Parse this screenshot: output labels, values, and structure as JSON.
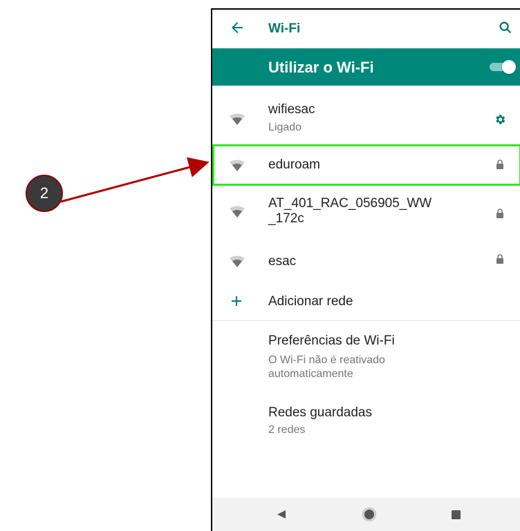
{
  "annotation": {
    "step_number": "2"
  },
  "appbar": {
    "title": "Wi-Fi",
    "back_icon": "arrow-left-icon",
    "search_icon": "search-icon"
  },
  "toggle": {
    "label": "Utilizar o Wi-Fi",
    "state": "on"
  },
  "networks": [
    {
      "name": "wifiesac",
      "status": "Ligado",
      "right_icon": "gear-icon"
    },
    {
      "name": "eduroam",
      "status": "",
      "right_icon": "lock-icon",
      "highlighted": true
    },
    {
      "name": "AT_401_RAC_056905_WW",
      "name_line2": "_172c",
      "status": "",
      "right_icon": "lock-icon"
    },
    {
      "name": "esac",
      "status": "",
      "right_icon": "lock-icon"
    }
  ],
  "add_network": {
    "label": "Adicionar rede",
    "icon": "plus-icon"
  },
  "preferences": {
    "title": "Preferências de Wi-Fi",
    "subtitle_line1": "O Wi-Fi não é reativado",
    "subtitle_line2": "automaticamente"
  },
  "saved": {
    "title": "Redes guardadas",
    "subtitle": "2 redes"
  },
  "navbar": {
    "back_icon": "nav-back-icon",
    "home_icon": "nav-home-icon",
    "recents_icon": "nav-recents-icon"
  },
  "colors": {
    "accent": "#00796b",
    "toggle_bar": "#00897b",
    "highlight": "#2ee81f",
    "arrow": "#b00000"
  }
}
